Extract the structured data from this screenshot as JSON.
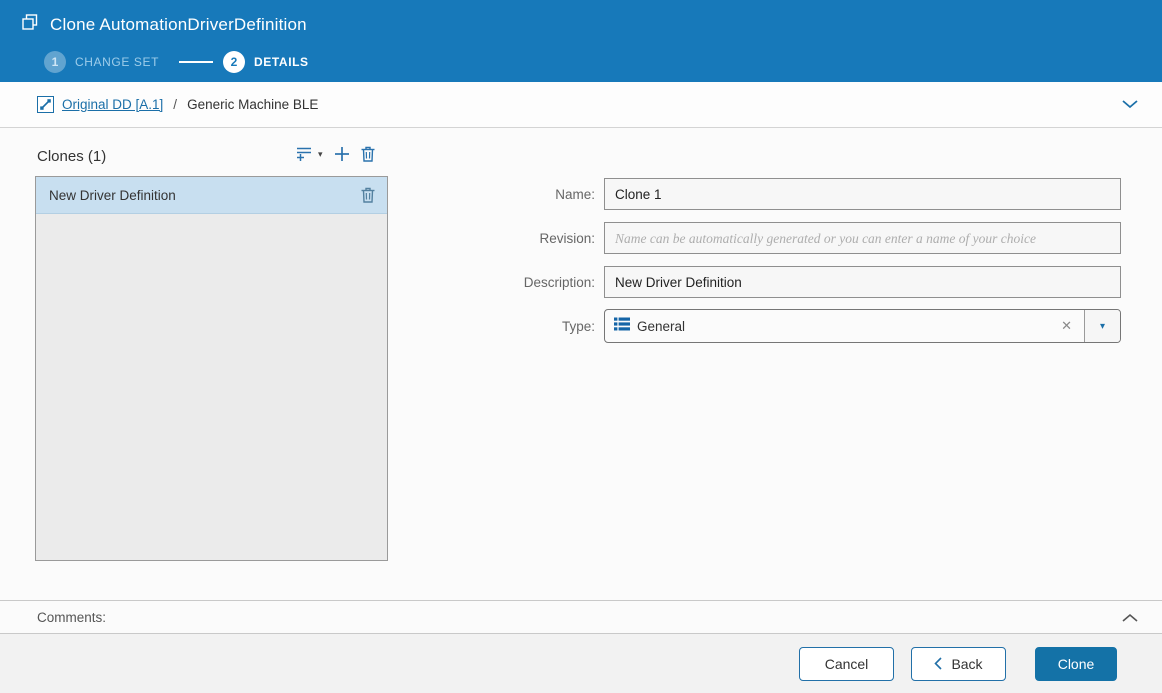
{
  "header": {
    "title": "Clone AutomationDriverDefinition",
    "steps": [
      {
        "number": "1",
        "label": "CHANGE SET",
        "state": "completed"
      },
      {
        "number": "2",
        "label": "DETAILS",
        "state": "active"
      }
    ]
  },
  "breadcrumb": {
    "link": "Original DD [A.1]",
    "separator": "/",
    "current": "Generic Machine BLE"
  },
  "clones_panel": {
    "title": "Clones (1)",
    "items": [
      {
        "name": "New Driver Definition",
        "selected": true
      }
    ]
  },
  "form": {
    "fields": [
      {
        "label": "Name:",
        "value": "Clone 1"
      },
      {
        "label": "Revision:",
        "value": "",
        "placeholder": "Name can be automatically generated or you can enter a name of your choice"
      },
      {
        "label": "Description:",
        "value": "New Driver Definition"
      },
      {
        "label": "Type:",
        "value": "General"
      }
    ]
  },
  "comments": {
    "label": "Comments:"
  },
  "footer": {
    "buttons": [
      {
        "label": "Cancel"
      },
      {
        "label": "Back"
      },
      {
        "label": "Clone",
        "primary": true
      }
    ]
  },
  "icons": {
    "clone": "copy-squares",
    "breadcrumb_link": "related-item",
    "expand": "chevron-down",
    "collapse": "chevron-up",
    "add_multiple": "list-plus",
    "add_multiple_caret": "▾",
    "add": "plus",
    "delete": "trash",
    "type_value": "list",
    "combo_clear": "✕",
    "combo_caret": "▾",
    "back_chevron": "chevron-left"
  },
  "colors": {
    "header_blue": "#1779ba",
    "accent_blue": "#2270a8",
    "link_blue": "#1b6fa8",
    "primary_button": "#1472a7",
    "selected_item": "#c8dff0",
    "list_background": "#ebebeb",
    "footer_background": "#f2f2f2"
  }
}
